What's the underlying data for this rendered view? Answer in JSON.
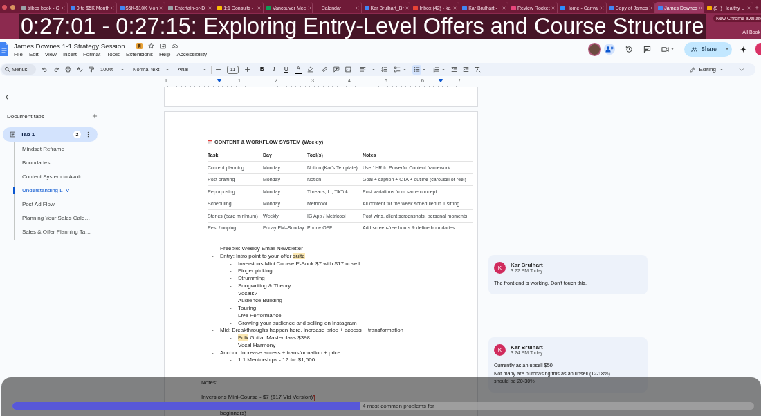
{
  "browser": {
    "tabs": [
      {
        "title": "tribes book - G",
        "color": "#9aa0a6",
        "selected": false
      },
      {
        "title": "0 to $5K Month",
        "color": "#4285f4",
        "selected": false
      },
      {
        "title": "$5K-$10K Mon",
        "color": "#4285f4",
        "selected": false
      },
      {
        "title": "Entertain-or-D",
        "color": "#9aa0a6",
        "selected": false
      },
      {
        "title": "1:1 Consults -",
        "color": "#fbbc04",
        "selected": false
      },
      {
        "title": "Vancouver Mee",
        "color": "#0f9d58",
        "selected": false
      },
      {
        "title": "Calendar",
        "selected": false
      },
      {
        "title": "Kar Brulhart_Br",
        "color": "#4285f4",
        "selected": false
      },
      {
        "title": "Inbox (42) - ka",
        "color": "#ea4335",
        "selected": false
      },
      {
        "title": "Kar Brulhart -",
        "color": "#4285f4",
        "selected": false
      },
      {
        "title": "Review Rocket",
        "color": "#e8457c",
        "selected": false
      },
      {
        "title": "Home - Canva",
        "color": "#2d8cff",
        "selected": false
      },
      {
        "title": "Copy of James",
        "color": "#4285f4",
        "selected": false
      },
      {
        "title": "James Downes",
        "color": "#4285f4",
        "selected": true
      },
      {
        "title": "(9+) Healthy L",
        "color": "#f9ab00",
        "selected": false
      }
    ],
    "update_notice": "New Chrome availab",
    "bookmarks_label": "All Book"
  },
  "caption": "0:27:01 - 0:27:15: Exploring Entry-Level Offers and Course Structure",
  "document": {
    "title": "James Downes 1-1 Strategy Session",
    "menu": [
      "File",
      "Edit",
      "View",
      "Insert",
      "Format",
      "Tools",
      "Extensions",
      "Help",
      "Accessibility"
    ],
    "share_label": "Share"
  },
  "toolbar": {
    "menus_placeholder": "Menus",
    "zoom": "100%",
    "style": "Normal text",
    "font": "Arial",
    "font_size": "11",
    "text_buttons": [
      {
        "kind": "bold",
        "label": "B"
      },
      {
        "kind": "italic",
        "label": "I"
      },
      {
        "kind": "underline",
        "label": "U"
      },
      {
        "kind": "color",
        "label": "A"
      }
    ],
    "list_buttons": [
      {
        "kind": "checklist",
        "selected": false
      },
      {
        "kind": "bulleted",
        "selected": true
      },
      {
        "kind": "numbered",
        "selected": false
      }
    ],
    "mode": "Editing"
  },
  "ruler": [
    "1",
    "1",
    "2",
    "3",
    "4",
    "5",
    "6",
    "7"
  ],
  "sidebar": {
    "heading": "Document tabs",
    "tab": {
      "label": "Tab 1",
      "count": "2",
      "selected": true
    },
    "outline": [
      {
        "title": "Mindset Reframe",
        "selected": false
      },
      {
        "title": "Boundaries",
        "selected": false
      },
      {
        "title": "Content System to Avoid …",
        "selected": false
      },
      {
        "title": "Understanding LTV",
        "selected": true
      },
      {
        "title": "Post Ad Flow",
        "selected": false
      },
      {
        "title": "Planning Your Sales Cale…",
        "selected": false
      },
      {
        "title": "Sales & Offer Planning Ta…",
        "selected": false
      }
    ]
  },
  "page": {
    "table_title": "CONTENT & WORKFLOW SYSTEM (Weekly)",
    "table": {
      "columns": [
        "Task",
        "Day",
        "Tool(s)",
        "Notes"
      ],
      "rows": [
        [
          "Content planning",
          "Monday",
          "Notion (Kar's Template)",
          "Use 1HR to Powerful Content framework"
        ],
        [
          "Post drafting",
          "Monday",
          "Notion",
          "Goal + caption + CTA + outline (carousel or reel)"
        ],
        [
          "Repurposing",
          "Monday",
          "Threads, LI, TikTok",
          "Post variations from same concept"
        ],
        [
          "Scheduling",
          "Monday",
          "Metricool",
          "All content for the week scheduled in 1 sitting"
        ],
        [
          "Stories (bare minimum)",
          "Weekly",
          "IG App / Metricool",
          "Post wins, client screenshots, personal moments"
        ],
        [
          "Rest / unplug",
          "Friday PM–Sunday",
          "Phone OFF",
          "Add screen-free hours & define boundaries"
        ]
      ]
    },
    "list": [
      {
        "marker": "-",
        "text": "Freebie: Weekly Email Newsletter"
      },
      {
        "marker": "-",
        "parts": [
          {
            "text": "Entry: Intro point to your offer ",
            "commented": false
          },
          {
            "text": "suite",
            "commented": true
          }
        ],
        "children": [
          {
            "marker": "-",
            "text": "Inversions Mini Course E-Book $7 with $17 upsell"
          },
          {
            "marker": "-",
            "text": "Finger picking"
          },
          {
            "marker": "-",
            "text": "Strumming"
          },
          {
            "marker": "-",
            "text": "Songwriting & Theory"
          },
          {
            "marker": "-",
            "text": "Vocals?"
          },
          {
            "marker": "-",
            "text": "Audience Building"
          },
          {
            "marker": "-",
            "text": "Touring"
          },
          {
            "marker": "-",
            "text": "Live Performance"
          },
          {
            "marker": "-",
            "text": "Growing your audience and selling on Instagram"
          }
        ]
      },
      {
        "marker": "-",
        "text": "Mid: Breakthroughs happen here, increase price + access + transformation",
        "children": [
          {
            "marker": "-",
            "parts": [
              {
                "text": "Folk",
                "commented": true
              },
              {
                "text": " Guitar Masterclass $398",
                "commented": false
              }
            ]
          },
          {
            "marker": "-",
            "text": "Vocal Harmony"
          }
        ]
      },
      {
        "marker": "-",
        "text": "Anchor: Increase access + transformation + price",
        "children": [
          {
            "marker": "-",
            "text": "1:1 Mentorships - 12 for $1,500"
          }
        ]
      }
    ],
    "notes": [
      {
        "kind": "heading",
        "text": "Notes:",
        "cursor": false
      },
      {
        "kind": "line",
        "text": "Inversions Mini-Course - $7 ($17 Vid Version)",
        "cursor": true
      },
      {
        "kind": "tail",
        "text": "4 most common problems for",
        "cursor": false
      },
      {
        "kind": "indented",
        "text": "beginners)",
        "cursor": false
      }
    ]
  },
  "comments": [
    {
      "initial": "K",
      "author": "Kar Brulhart",
      "time": "3:22 PM Today",
      "lines": [
        "The front end is working. Don't touch this."
      ]
    },
    {
      "initial": "K",
      "author": "Kar Brulhart",
      "time": "3:24 PM Today",
      "lines": [
        "Currently as an upsell $50",
        "Not many are purchasing this as an upsell (12-18%)",
        "should be 20-30%"
      ]
    }
  ],
  "player": {
    "level": 0.468
  }
}
